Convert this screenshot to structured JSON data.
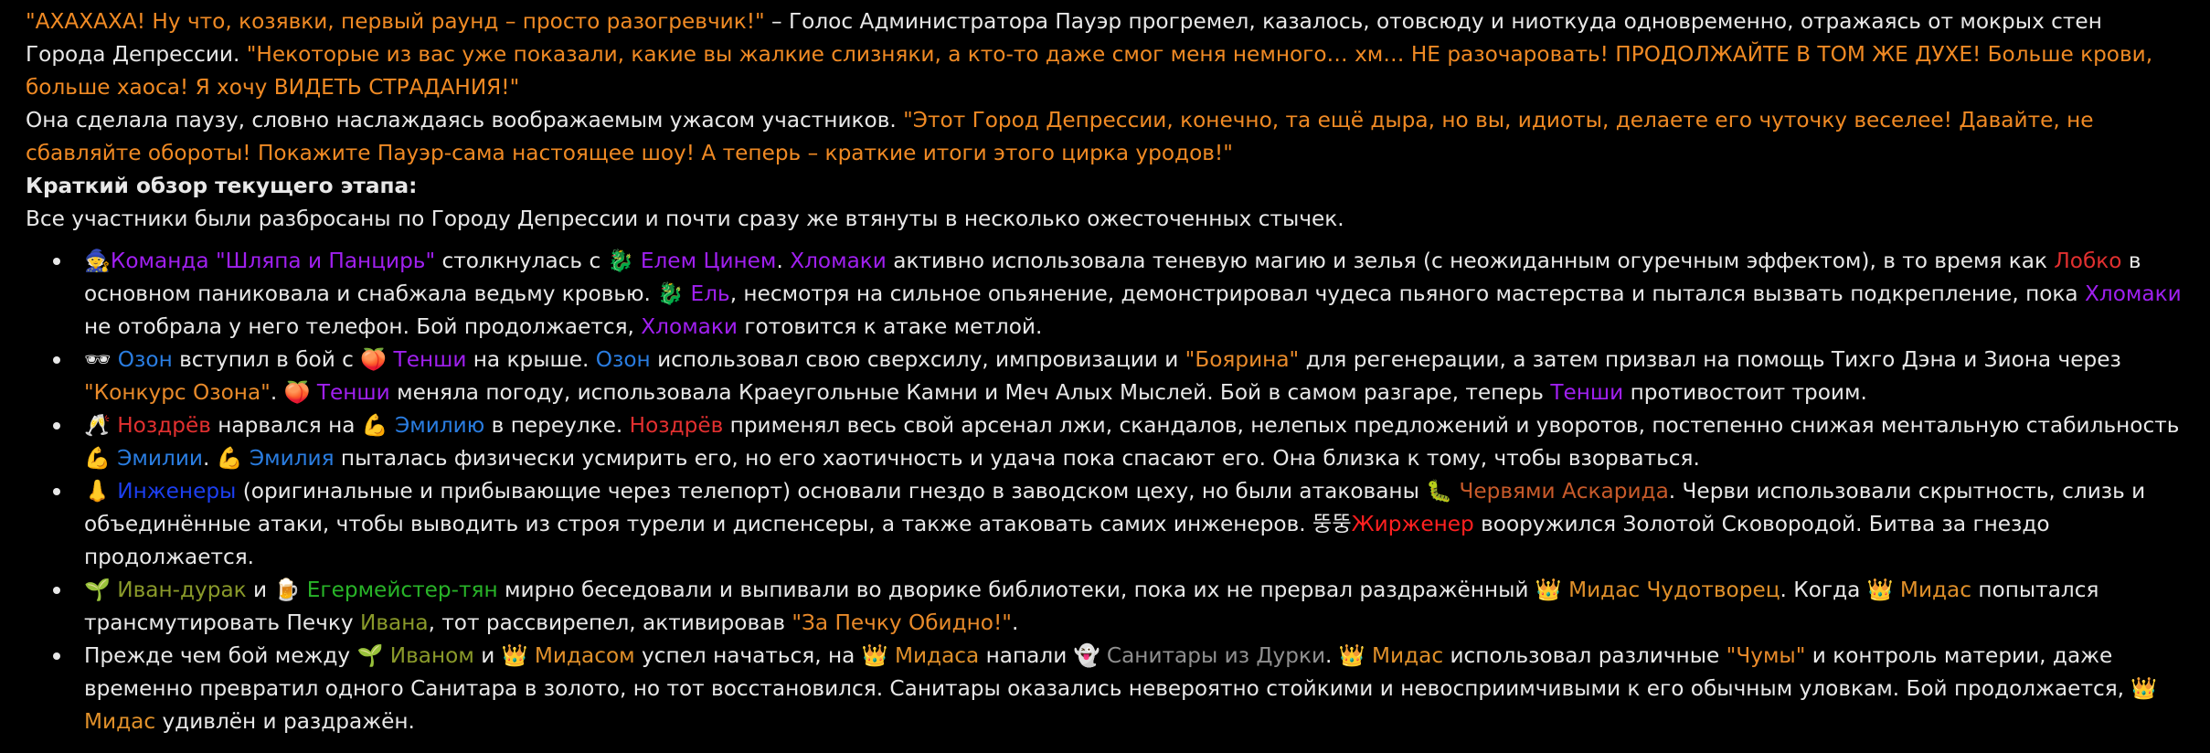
{
  "colors": {
    "text": "#e8e8e8",
    "background": "#000000",
    "quote": "#f08a24",
    "purple": "#a020f0",
    "blue": "#2a7de1",
    "deepblue": "#1c3ff0",
    "orange": "#e88a2a",
    "red": "#e23030",
    "brightred": "#ff2020",
    "rust": "#c85a2a",
    "olive": "#8a9a2a",
    "green": "#28b428",
    "gold": "#e0902a",
    "gray": "#909090"
  },
  "paragraphs": [
    {
      "spans": [
        {
          "t": "\"АХАХАХА! Ну что, козявки, первый раунд – просто разогревчик!\"",
          "c": "quote"
        },
        {
          "t": " – Голос Администратора Пауэр прогремел, казалось, отовсюду и ниоткуда одновременно, отражаясь от мокрых стен Города Депрессии. "
        },
        {
          "t": "\"Некоторые из вас уже показали, какие вы жалкие слизняки, а кто-то даже смог меня немного… хм… НЕ разочаровать! ПРОДОЛЖАЙТЕ В ТОМ ЖЕ ДУХЕ! Больше крови, больше хаоса! Я хочу ВИДЕТЬ СТРАДАНИЯ!\"",
          "c": "quote"
        }
      ]
    },
    {
      "spans": [
        {
          "t": "Она сделала паузу, словно наслаждаясь воображаемым ужасом участников. "
        },
        {
          "t": "\"Этот Город Депрессии, конечно, та ещё дыра, но вы, идиоты, делаете его чуточку веселее! Давайте, не сбавляйте обороты! Покажите Пауэр-сама настоящее шоу! А теперь – краткие итоги этого цирка уродов!\"",
          "c": "quote"
        }
      ]
    },
    {
      "spans": [
        {
          "t": "Краткий обзор текущего этапа:",
          "b": true
        }
      ]
    },
    {
      "spans": [
        {
          "t": "Все участники были разбросаны по Городу Депрессии и почти сразу же втянуты в несколько ожесточенных стычек."
        }
      ]
    }
  ],
  "bullets": [
    {
      "spans": [
        {
          "t": "🧙",
          "icon": "witch-emoji-icon"
        },
        {
          "t": "Команда \"Шляпа и Панцирь\"",
          "c": "purple"
        },
        {
          "t": " столкнулась с "
        },
        {
          "t": "🐉",
          "icon": "dragon-emoji-icon"
        },
        {
          "t": " Елем Цинем",
          "c": "purple"
        },
        {
          "t": ". "
        },
        {
          "t": "Хломаки",
          "c": "purple"
        },
        {
          "t": " активно использовала теневую магию и зелья (с неожиданным огуречным эффектом), в то время как "
        },
        {
          "t": "Лобко",
          "c": "red"
        },
        {
          "t": " в основном паниковала и снабжала ведьму кровью. "
        },
        {
          "t": "🐉",
          "icon": "dragon-emoji-icon"
        },
        {
          "t": " Ель",
          "c": "purple"
        },
        {
          "t": ", несмотря на сильное опьянение, демонстрировал чудеса пьяного мастерства и пытался вызвать подкрепление, пока "
        },
        {
          "t": "Хломаки",
          "c": "purple"
        },
        {
          "t": " не отобрала у него телефон. Бой продолжается, "
        },
        {
          "t": "Хломаки",
          "c": "purple"
        },
        {
          "t": " готовится к атаке метлой."
        }
      ]
    },
    {
      "spans": [
        {
          "t": "🕶",
          "icon": "sunglasses-emoji-icon"
        },
        {
          "t": " Озон",
          "c": "blue"
        },
        {
          "t": " вступил в бой с "
        },
        {
          "t": "🍑",
          "icon": "peach-emoji-icon"
        },
        {
          "t": " Тенши",
          "c": "purple"
        },
        {
          "t": " на крыше. "
        },
        {
          "t": "Озон",
          "c": "blue"
        },
        {
          "t": " использовал свою сверхсилу, импровизации и "
        },
        {
          "t": "\"Боярина\"",
          "c": "orange"
        },
        {
          "t": " для регенерации, а затем призвал на помощь Тихго Дэна и Зиона через "
        },
        {
          "t": "\"Конкурс Озона\"",
          "c": "orange"
        },
        {
          "t": ". "
        },
        {
          "t": "🍑",
          "icon": "peach-emoji-icon"
        },
        {
          "t": " Тенши",
          "c": "purple"
        },
        {
          "t": " меняла погоду, использовала Краеугольные Камни и Меч Алых Мыслей. Бой в самом разгаре, теперь "
        },
        {
          "t": "Тенши",
          "c": "purple"
        },
        {
          "t": " противостоит троим."
        }
      ]
    },
    {
      "spans": [
        {
          "t": "🥂",
          "icon": "champagne-glasses-emoji-icon"
        },
        {
          "t": " Ноздрёв",
          "c": "red"
        },
        {
          "t": " нарвался на "
        },
        {
          "t": "💪",
          "icon": "flexed-biceps-emoji-icon"
        },
        {
          "t": " Эмилию",
          "c": "blue"
        },
        {
          "t": " в переулке. "
        },
        {
          "t": "Ноздрёв",
          "c": "red"
        },
        {
          "t": " применял весь свой арсенал лжи, скандалов, нелепых предложений и уворотов, постепенно снижая ментальную стабильность "
        },
        {
          "t": "💪",
          "icon": "flexed-biceps-emoji-icon"
        },
        {
          "t": " Эмилии",
          "c": "blue"
        },
        {
          "t": ". "
        },
        {
          "t": "💪",
          "icon": "flexed-biceps-emoji-icon"
        },
        {
          "t": " Эмилия",
          "c": "blue"
        },
        {
          "t": " пыталась физически усмирить его, но его хаотичность и удача пока спасают его. Она близка к тому, чтобы взорваться."
        }
      ]
    },
    {
      "spans": [
        {
          "t": "👃",
          "icon": "nose-emoji-icon"
        },
        {
          "t": " Инженеры",
          "c": "deepblue"
        },
        {
          "t": " (оригинальные и прибывающие через телепорт) основали гнездо в заводском цеху, но были атакованы "
        },
        {
          "t": "🐛",
          "icon": "worm-emoji-icon"
        },
        {
          "t": " Червями Аскарида",
          "c": "rust"
        },
        {
          "t": ". Черви использовали скрытность, слизь и объединённые атаки, чтобы выводить из строя турели и диспенсеры, а также атаковать самих инженеров. "
        },
        {
          "t": "뚱뚱",
          "icon": "korean-glyph-icon"
        },
        {
          "t": "Жирженер",
          "c": "brightred"
        },
        {
          "t": " вооружился Золотой Сковородой. Битва за гнездо продолжается."
        }
      ]
    },
    {
      "spans": [
        {
          "t": "🌱",
          "icon": "seedling-emoji-icon"
        },
        {
          "t": " Иван-дурак",
          "c": "olive"
        },
        {
          "t": " и "
        },
        {
          "t": "🍺",
          "icon": "beer-mug-emoji-icon"
        },
        {
          "t": " Егермейстер-тян",
          "c": "green"
        },
        {
          "t": " мирно беседовали и выпивали во дворике библиотеки, пока их не прервал раздражённый "
        },
        {
          "t": "👑",
          "icon": "crown-emoji-icon"
        },
        {
          "t": " Мидас Чудотворец",
          "c": "gold"
        },
        {
          "t": ". Когда "
        },
        {
          "t": "👑",
          "icon": "crown-emoji-icon"
        },
        {
          "t": " Мидас",
          "c": "gold"
        },
        {
          "t": " попытался трансмутировать Печку "
        },
        {
          "t": "Ивана",
          "c": "olive"
        },
        {
          "t": ", тот рассвирепел, активировав "
        },
        {
          "t": "\"За Печку Обидно!\"",
          "c": "orange"
        },
        {
          "t": "."
        }
      ]
    },
    {
      "spans": [
        {
          "t": "Прежде чем бой между "
        },
        {
          "t": "🌱",
          "icon": "seedling-emoji-icon"
        },
        {
          "t": " Иваном",
          "c": "olive"
        },
        {
          "t": " и "
        },
        {
          "t": "👑",
          "icon": "crown-emoji-icon"
        },
        {
          "t": " Мидасом",
          "c": "gold"
        },
        {
          "t": " успел начаться, на "
        },
        {
          "t": "👑",
          "icon": "crown-emoji-icon"
        },
        {
          "t": " Мидаса",
          "c": "gold"
        },
        {
          "t": " напали "
        },
        {
          "t": "👻",
          "icon": "ghost-emoji-icon"
        },
        {
          "t": " Санитары из Дурки",
          "c": "gray"
        },
        {
          "t": ". "
        },
        {
          "t": "👑",
          "icon": "crown-emoji-icon"
        },
        {
          "t": " Мидас",
          "c": "gold"
        },
        {
          "t": " использовал различные "
        },
        {
          "t": "\"Чумы\"",
          "c": "orange"
        },
        {
          "t": " и контроль материи, даже временно превратил одного Санитара в золото, но тот восстановился. Санитары оказались невероятно стойкими и невосприимчивыми к его обычным уловкам. Бой продолжается, "
        },
        {
          "t": "👑",
          "icon": "crown-emoji-icon"
        },
        {
          "t": " Мидас",
          "c": "gold"
        },
        {
          "t": " удивлён и раздражён."
        }
      ]
    }
  ]
}
